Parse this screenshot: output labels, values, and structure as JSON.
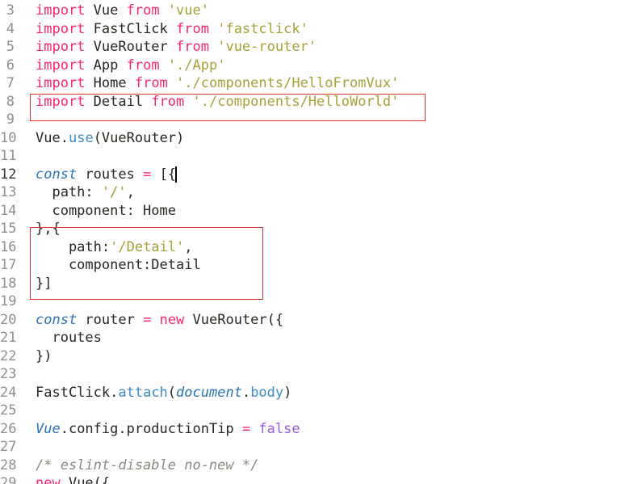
{
  "editor": {
    "lines": [
      {
        "n": "3",
        "tokens": [
          {
            "t": "import",
            "c": "kw"
          },
          {
            "t": " Vue ",
            "c": "pl"
          },
          {
            "t": "from",
            "c": "kw"
          },
          {
            "t": " ",
            "c": "pl"
          },
          {
            "t": "'vue'",
            "c": "str"
          }
        ]
      },
      {
        "n": "4",
        "tokens": [
          {
            "t": "import",
            "c": "kw"
          },
          {
            "t": " FastClick ",
            "c": "pl"
          },
          {
            "t": "from",
            "c": "kw"
          },
          {
            "t": " ",
            "c": "pl"
          },
          {
            "t": "'fastclick'",
            "c": "str"
          }
        ]
      },
      {
        "n": "5",
        "tokens": [
          {
            "t": "import",
            "c": "kw"
          },
          {
            "t": " VueRouter ",
            "c": "pl"
          },
          {
            "t": "from",
            "c": "kw"
          },
          {
            "t": " ",
            "c": "pl"
          },
          {
            "t": "'vue-router'",
            "c": "str"
          }
        ]
      },
      {
        "n": "6",
        "tokens": [
          {
            "t": "import",
            "c": "kw"
          },
          {
            "t": " App ",
            "c": "pl"
          },
          {
            "t": "from",
            "c": "kw"
          },
          {
            "t": " ",
            "c": "pl"
          },
          {
            "t": "'./App'",
            "c": "str"
          }
        ]
      },
      {
        "n": "7",
        "tokens": [
          {
            "t": "import",
            "c": "kw"
          },
          {
            "t": " Home ",
            "c": "pl"
          },
          {
            "t": "from",
            "c": "kw"
          },
          {
            "t": " ",
            "c": "pl"
          },
          {
            "t": "'./components/HelloFromVux'",
            "c": "str"
          }
        ]
      },
      {
        "n": "8",
        "tokens": [
          {
            "t": "import",
            "c": "kw"
          },
          {
            "t": " Detail ",
            "c": "pl"
          },
          {
            "t": "from",
            "c": "kw"
          },
          {
            "t": " ",
            "c": "pl"
          },
          {
            "t": "'./components/HelloWorld'",
            "c": "str"
          }
        ]
      },
      {
        "n": "9",
        "tokens": []
      },
      {
        "n": "10",
        "tokens": [
          {
            "t": "Vue",
            "c": "pl"
          },
          {
            "t": ".",
            "c": "pl"
          },
          {
            "t": "use",
            "c": "fn"
          },
          {
            "t": "(VueRouter)",
            "c": "pl"
          }
        ]
      },
      {
        "n": "11",
        "tokens": []
      },
      {
        "n": "12",
        "active": true,
        "tokens": [
          {
            "t": "const",
            "c": "it"
          },
          {
            "t": " routes ",
            "c": "pl"
          },
          {
            "t": "=",
            "c": "kw"
          },
          {
            "t": " [{",
            "c": "pl"
          }
        ]
      },
      {
        "n": "13",
        "tokens": [
          {
            "t": "  path: ",
            "c": "pl"
          },
          {
            "t": "'/'",
            "c": "str"
          },
          {
            "t": ",",
            "c": "pl"
          }
        ]
      },
      {
        "n": "14",
        "tokens": [
          {
            "t": "  component: Home",
            "c": "pl"
          }
        ]
      },
      {
        "n": "15",
        "tokens": [
          {
            "t": "},{",
            "c": "pl"
          }
        ]
      },
      {
        "n": "16",
        "tokens": [
          {
            "t": "    path:",
            "c": "pl"
          },
          {
            "t": "'/Detail'",
            "c": "str"
          },
          {
            "t": ",",
            "c": "pl"
          }
        ]
      },
      {
        "n": "17",
        "tokens": [
          {
            "t": "    component:Detail",
            "c": "pl"
          }
        ]
      },
      {
        "n": "18",
        "tokens": [
          {
            "t": "}]",
            "c": "pl"
          }
        ]
      },
      {
        "n": "19",
        "tokens": []
      },
      {
        "n": "20",
        "tokens": [
          {
            "t": "const",
            "c": "it"
          },
          {
            "t": " router ",
            "c": "pl"
          },
          {
            "t": "=",
            "c": "kw"
          },
          {
            "t": " ",
            "c": "pl"
          },
          {
            "t": "new",
            "c": "kw"
          },
          {
            "t": " VueRouter({",
            "c": "pl"
          }
        ]
      },
      {
        "n": "21",
        "tokens": [
          {
            "t": "  routes",
            "c": "pl"
          }
        ]
      },
      {
        "n": "22",
        "tokens": [
          {
            "t": "})",
            "c": "pl"
          }
        ]
      },
      {
        "n": "23",
        "tokens": []
      },
      {
        "n": "24",
        "tokens": [
          {
            "t": "FastClick",
            "c": "pl"
          },
          {
            "t": ".",
            "c": "pl"
          },
          {
            "t": "attach",
            "c": "fn"
          },
          {
            "t": "(",
            "c": "pl"
          },
          {
            "t": "document",
            "c": "it"
          },
          {
            "t": ".",
            "c": "pl"
          },
          {
            "t": "body",
            "c": "fn"
          },
          {
            "t": ")",
            "c": "pl"
          }
        ]
      },
      {
        "n": "25",
        "tokens": []
      },
      {
        "n": "26",
        "tokens": [
          {
            "t": "Vue",
            "c": "it"
          },
          {
            "t": ".config.productionTip ",
            "c": "pl"
          },
          {
            "t": "=",
            "c": "kw"
          },
          {
            "t": " ",
            "c": "pl"
          },
          {
            "t": "false",
            "c": "num"
          }
        ]
      },
      {
        "n": "27",
        "tokens": []
      },
      {
        "n": "28",
        "tokens": [
          {
            "t": "/* eslint-disable no-new */",
            "c": "cm"
          }
        ]
      },
      {
        "n": "29",
        "tokens": [
          {
            "t": "new",
            "c": "kw"
          },
          {
            "t": " Vue({",
            "c": "pl"
          }
        ]
      }
    ]
  },
  "colors": {
    "keyword": "#f92672",
    "string": "#a6a23a",
    "function": "#3e8bc6",
    "storage": "#2b73b5",
    "constant": "#9a5bd6",
    "comment": "#8a8a80",
    "highlight_box": "#e0322f"
  }
}
